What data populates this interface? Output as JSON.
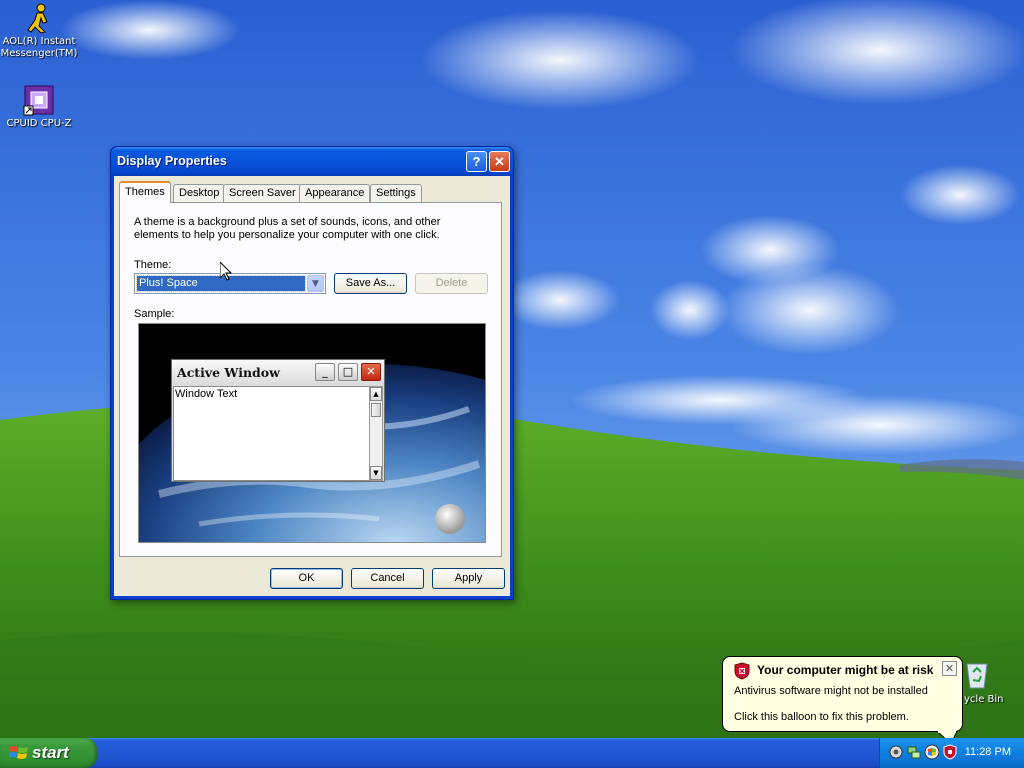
{
  "desktop": {
    "icons": [
      {
        "label": "AOL(R) Instant\nMessenger(TM)",
        "icon": "aim-icon"
      },
      {
        "label": "CPUID CPU-Z",
        "icon": "cpu-z-icon"
      }
    ],
    "recycle_bin_label": "ycle Bin"
  },
  "window": {
    "title": "Display Properties",
    "help_label": "?",
    "close_label": "✕",
    "tabs": [
      "Themes",
      "Desktop",
      "Screen Saver",
      "Appearance",
      "Settings"
    ],
    "active_tab": "Themes",
    "description": "A theme is a background plus a set of sounds, icons, and other elements to help you personalize your computer with one click.",
    "theme_label": "Theme:",
    "theme_value": "Plus! Space",
    "save_as_label": "Save As...",
    "delete_label": "Delete",
    "sample_label": "Sample:",
    "preview": {
      "title": "Active Window",
      "client_text": "Window Text"
    },
    "ok_label": "OK",
    "cancel_label": "Cancel",
    "apply_label": "Apply"
  },
  "balloon": {
    "title": "Your computer might be at risk",
    "line1": "Antivirus software might not be installed",
    "line2": "Click this balloon to fix this problem.",
    "close_label": "✕"
  },
  "taskbar": {
    "start_label": "start",
    "clock": "11:28 PM"
  },
  "colors": {
    "title_blue": "#0751da",
    "start_green": "#3c9a3c",
    "tray_blue": "#0f7ee0",
    "balloon_bg": "#ffffe1"
  }
}
